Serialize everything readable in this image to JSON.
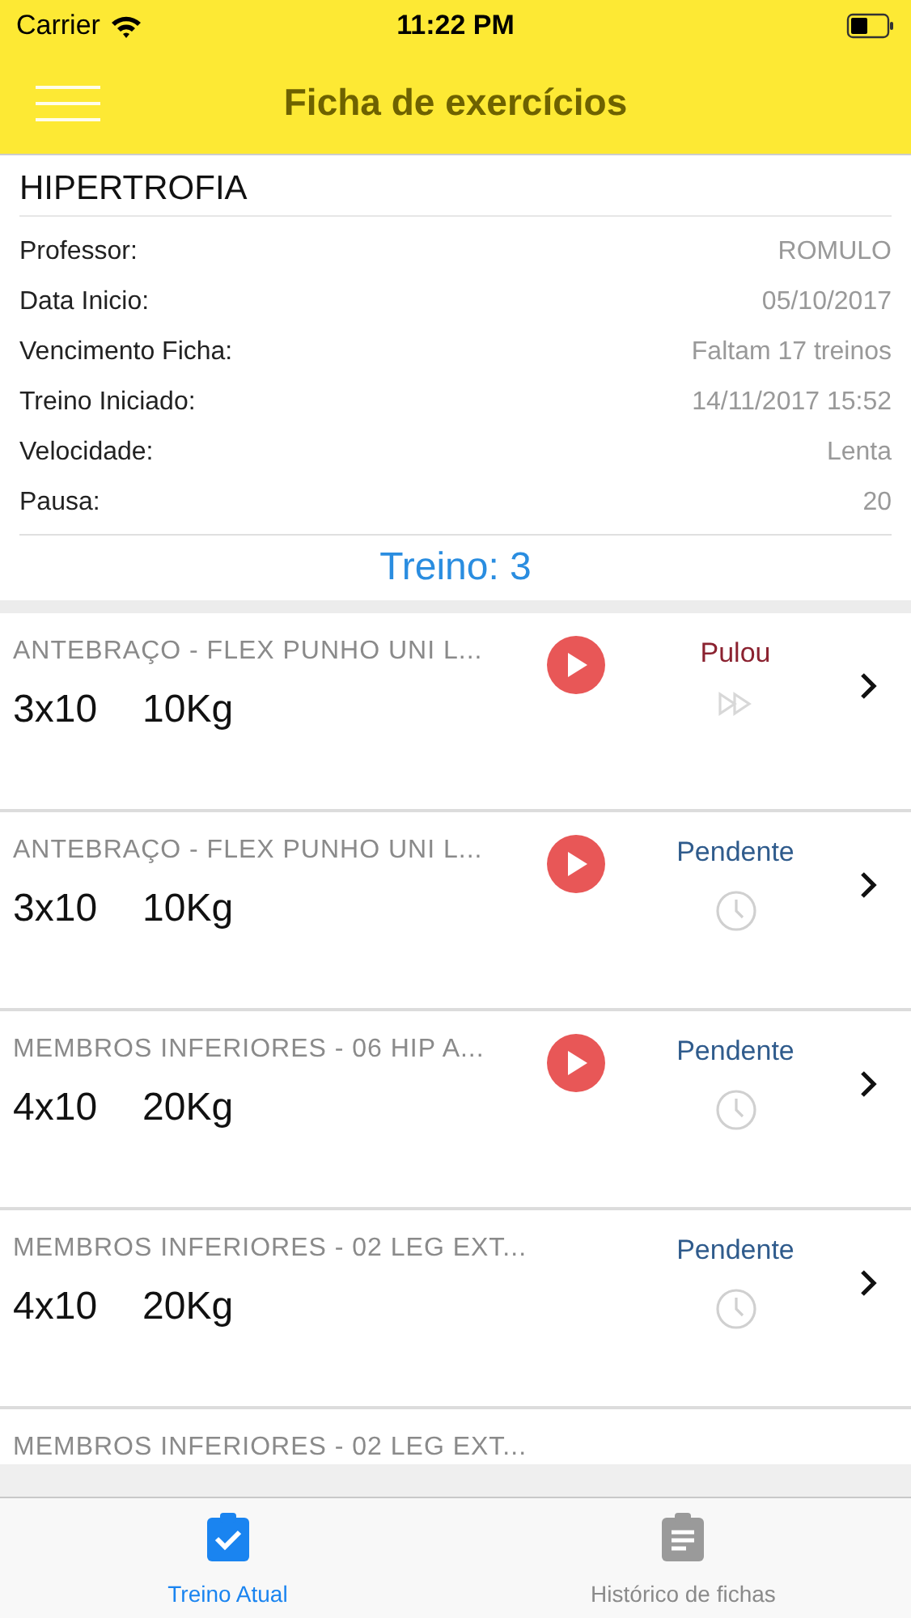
{
  "status_bar": {
    "carrier": "Carrier",
    "time": "11:22 PM"
  },
  "header": {
    "title": "Ficha de exercícios"
  },
  "plan": {
    "name": "HIPERTROFIA",
    "fields": [
      {
        "label": "Professor:",
        "value": "ROMULO"
      },
      {
        "label": "Data Inicio:",
        "value": "05/10/2017"
      },
      {
        "label": "Vencimento Ficha:",
        "value": "Faltam 17 treinos"
      },
      {
        "label": "Treino Iniciado:",
        "value": "14/11/2017 15:52"
      },
      {
        "label": "Velocidade:",
        "value": "Lenta"
      },
      {
        "label": "Pausa:",
        "value": "20"
      }
    ],
    "session": "Treino: 3"
  },
  "exercises": [
    {
      "name": "ANTEBRAÇO - FLEX PUNHO UNI L...",
      "sets": "3x10",
      "weight": "10Kg",
      "playable": true,
      "status": "Pulou",
      "kind": "skipped"
    },
    {
      "name": "ANTEBRAÇO - FLEX PUNHO UNI L...",
      "sets": "3x10",
      "weight": "10Kg",
      "playable": true,
      "status": "Pendente",
      "kind": "pending"
    },
    {
      "name": "MEMBROS INFERIORES - 06 HIP A...",
      "sets": "4x10",
      "weight": "20Kg",
      "playable": true,
      "status": "Pendente",
      "kind": "pending"
    },
    {
      "name": "MEMBROS INFERIORES - 02 LEG EXT...",
      "sets": "4x10",
      "weight": "20Kg",
      "playable": false,
      "status": "Pendente",
      "kind": "pending"
    },
    {
      "name": "MEMBROS INFERIORES - 02 LEG EXT...",
      "kind": "partial"
    }
  ],
  "tabs": [
    {
      "label": "Treino Atual",
      "selected": true,
      "kind": "current"
    },
    {
      "label": "Histórico de fichas",
      "selected": false,
      "kind": "history"
    }
  ]
}
